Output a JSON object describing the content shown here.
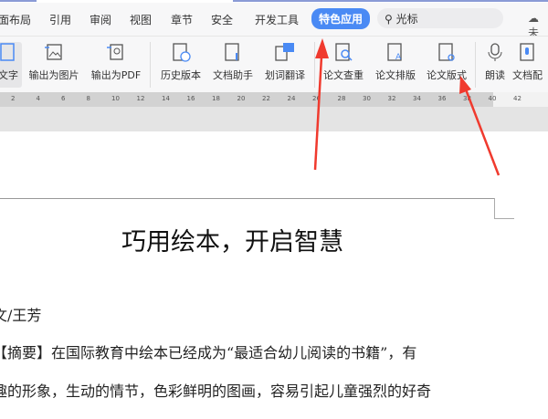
{
  "menu": {
    "items": [
      "面布局",
      "引用",
      "审阅",
      "视图",
      "章节",
      "安全",
      "开发工具"
    ],
    "active": "特色应用",
    "search_placeholder": "光标",
    "cloud_label": "未"
  },
  "toolbar": {
    "items": [
      "文字",
      "输出为图片",
      "输出为PDF",
      "历史版本",
      "文档助手",
      "划词翻译",
      "论文查重",
      "论文排版",
      "论文版式",
      "朗读",
      "文档配"
    ]
  },
  "ruler": {
    "ticks": [
      "2",
      "4",
      "6",
      "8",
      "10",
      "12",
      "14",
      "16",
      "18",
      "20",
      "22",
      "24",
      "26",
      "28",
      "30",
      "32",
      "34",
      "36",
      "38",
      "40",
      "42"
    ]
  },
  "document": {
    "title": "巧用绘本，开启智慧",
    "author": "文/王芳",
    "lines": [
      "【摘要】在国际教育中绘本已经成为“最适合幼儿阅读的书籍”，有",
      "趣的形象，生动的情节，色彩鲜明的图画，容易引起儿童强烈的好奇"
    ]
  },
  "colors": {
    "accent": "#4a8af4",
    "arrow": "#f03a2e"
  }
}
